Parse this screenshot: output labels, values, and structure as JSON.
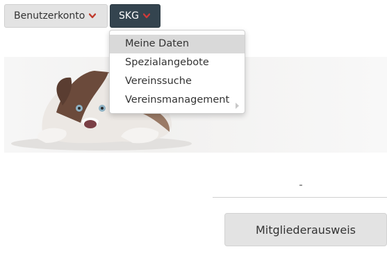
{
  "header": {
    "account_button": {
      "label": "Benutzerkonto",
      "caret_icon": "caret-down-icon"
    },
    "org_button": {
      "label": "SKG",
      "caret_icon": "caret-down-icon"
    }
  },
  "dropdown": {
    "items": [
      {
        "label": "Meine Daten",
        "active": true
      },
      {
        "label": "Spezialangebote"
      },
      {
        "label": "Vereinssuche"
      },
      {
        "label": "Vereinsmanagement",
        "has_submenu": true,
        "submenu_icon": "chevron-right-icon"
      }
    ]
  },
  "main": {
    "hero_image": "dog-lying-image",
    "membership_button": {
      "label": "Mitgliederausweis"
    }
  },
  "colors": {
    "accent_dark": "#34444f",
    "caret_red": "#c0392b",
    "button_light": "#e3e3e3",
    "menu_active": "#d9d9d9"
  }
}
